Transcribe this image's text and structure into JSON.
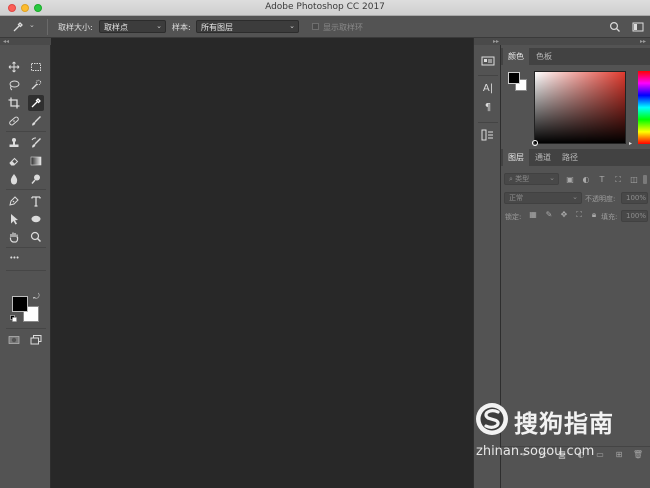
{
  "window": {
    "title": "Adobe Photoshop CC 2017"
  },
  "options_bar": {
    "sample_size_label": "取样大小:",
    "sample_size_value": "取样点",
    "sample_label": "样本:",
    "sample_value": "所有图层",
    "show_ring_label": "显示取样环"
  },
  "color_panel": {
    "tabs": [
      "颜色",
      "色板"
    ],
    "foreground": "#000000",
    "background": "#ffffff"
  },
  "layers_panel": {
    "tabs": [
      "图层",
      "通道",
      "路径"
    ],
    "filter_label": "类型",
    "blend_mode": "正常",
    "opacity_label": "不透明度:",
    "opacity_value": "100%",
    "lock_label": "锁定:",
    "fill_label": "填充:",
    "fill_value": "100%"
  },
  "dock": {
    "paragraph_symbol": "¶",
    "char_symbol": "A|"
  },
  "toolbar": {
    "more_label": "•••"
  },
  "watermark": {
    "brand": "搜狗指南",
    "url": "zhinan.sogou.com"
  },
  "colors": {
    "ui_panel": "#535353",
    "canvas": "#282828",
    "accent_red": "#e03a2e"
  }
}
